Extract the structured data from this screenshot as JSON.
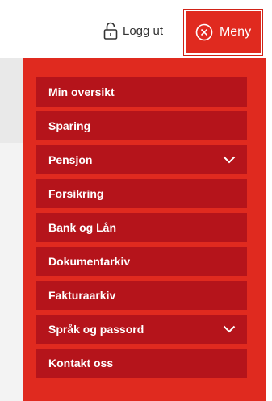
{
  "header": {
    "logout_label": "Logg ut",
    "menu_label": "Meny"
  },
  "icons": {
    "logout": "padlock-icon",
    "menu": "close-circle-icon",
    "expand": "chevron-down-icon"
  },
  "colors": {
    "menu_background": "#e02a1f",
    "menu_item_background": "#b5141b",
    "text_on_red": "#ffffff"
  },
  "menu": {
    "items": [
      {
        "label": "Min oversikt",
        "expandable": false
      },
      {
        "label": "Sparing",
        "expandable": false
      },
      {
        "label": "Pensjon",
        "expandable": true
      },
      {
        "label": "Forsikring",
        "expandable": false
      },
      {
        "label": "Bank og Lån",
        "expandable": false
      },
      {
        "label": "Dokumentarkiv",
        "expandable": false
      },
      {
        "label": "Fakturaarkiv",
        "expandable": false
      },
      {
        "label": "Språk og passord",
        "expandable": true
      },
      {
        "label": "Kontakt oss",
        "expandable": false
      }
    ]
  }
}
